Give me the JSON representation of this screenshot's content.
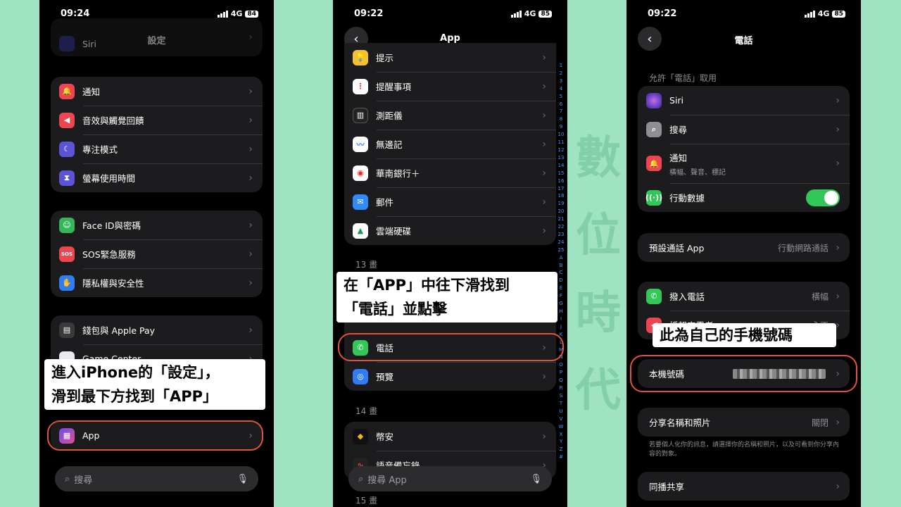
{
  "status": {
    "p1_time": "09:24",
    "p2_time": "09:22",
    "p3_time": "09:22",
    "net": "4G",
    "p1_battery": "84",
    "p2_battery": "85",
    "p3_battery": "85"
  },
  "p1": {
    "title": "設定",
    "top_item": "Siri",
    "g1": [
      "通知",
      "音效與觸覺回饋",
      "專注模式",
      "螢幕使用時間"
    ],
    "g2": [
      "Face ID與密碼",
      "SOS緊急服務",
      "隱私權與安全性"
    ],
    "g3": [
      "錢包與 Apple Pay",
      "Game Center"
    ],
    "sos_icon": "SOS",
    "app_item": "App",
    "search_placeholder": "搜尋",
    "callout_line1": "進入iPhone的「設定」，",
    "callout_line2": "滑到最下方找到「APP」"
  },
  "p2": {
    "title": "App",
    "list1": [
      "提示",
      "提醒事項",
      "測距儀",
      "無邊記",
      "華南銀行＋",
      "郵件",
      "雲端硬碟"
    ],
    "sec13": "13 畫",
    "phone_item": "電話",
    "preview_item": "預覽",
    "sec14": "14 畫",
    "binance": "幣安",
    "memo": "語音備忘錄",
    "sec15": "15 畫",
    "search_placeholder": "搜尋 App",
    "callout_line1": "在「APP」中往下滑找到",
    "callout_line2": "「電話」並點擊",
    "index": [
      "1",
      "2",
      "3",
      "4",
      "5",
      "6",
      "7",
      "8",
      "9",
      "10",
      "11",
      "12",
      "13",
      "14",
      "15",
      "16",
      "17",
      "18",
      "19",
      "20",
      "21",
      "22",
      "23",
      "24",
      "25",
      "A",
      "B",
      "C",
      "D",
      "E",
      "F",
      "G",
      "H",
      "I",
      "J",
      "K",
      "L",
      "M",
      "N",
      "O",
      "P",
      "Q",
      "R",
      "S",
      "T",
      "U",
      "V",
      "W",
      "X",
      "Y",
      "Z",
      "#"
    ]
  },
  "p3": {
    "title": "電話",
    "allow_head": "允許「電話」取用",
    "siri": "Siri",
    "search": "搜尋",
    "notify": "通知",
    "notify_sub": "橫幅、聲音、標記",
    "cellular": "行動數據",
    "default_app": "預設通話 App",
    "default_app_val": "行動網路通話",
    "incoming": "撥入電話",
    "incoming_val": "橫幅",
    "announce": "播報來電者",
    "announce_val": "永不",
    "my_number": "本機號碼",
    "share": "分享名稱和照片",
    "share_val": "關閉",
    "share_note": "若要個人化你的訊息，請選擇你的名稱和照片，以及可看到你分享內容的對象。",
    "shareplay": "同播共享",
    "callout": "此為自己的手機號碼"
  },
  "watermark": "數位時代",
  "colors": {
    "accent_ring": "#e0533c",
    "bg": "#9fe3c3",
    "toggle_on": "#33c759"
  }
}
